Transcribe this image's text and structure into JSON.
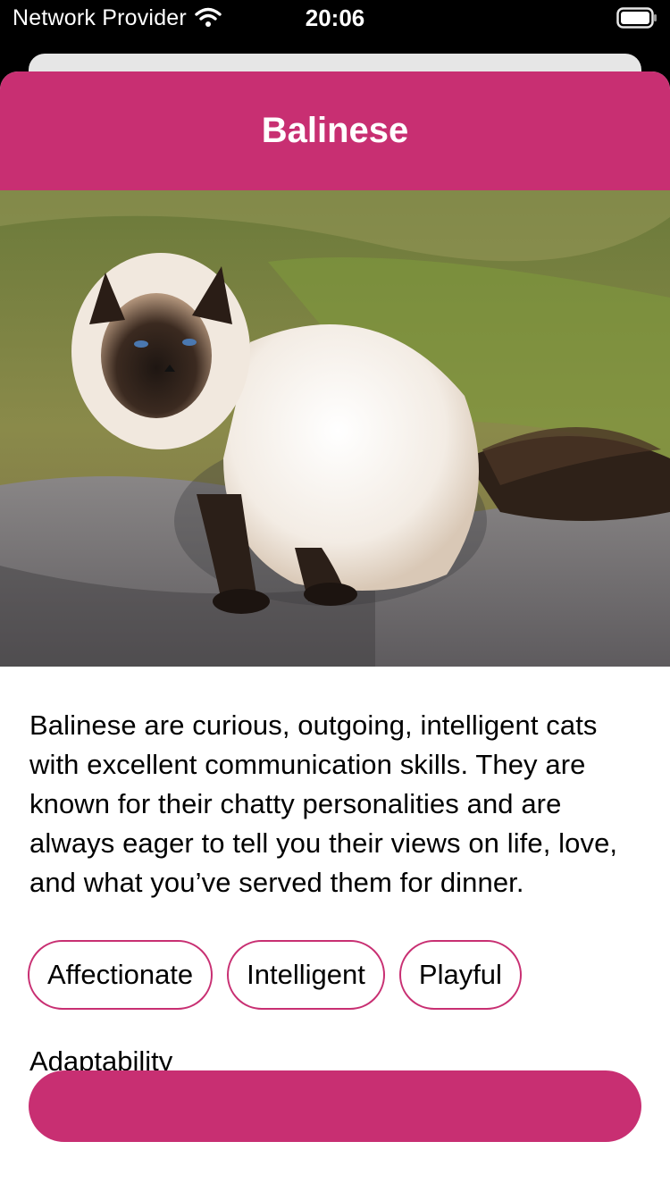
{
  "status_bar": {
    "carrier": "Network Provider",
    "time": "20:06",
    "wifi_icon": "wifi-icon",
    "battery_icon": "battery-icon"
  },
  "breed": {
    "title": "Balinese",
    "photo_alt": "Balinese cat",
    "description": "Balinese are curious, outgoing, intelligent cats with excellent communication skills. They are known for their chatty personalities and are always eager to tell you their views on life, love, and what you’ve served them for dinner.",
    "temperament_tags": [
      "Affectionate",
      "Intelligent",
      "Playful"
    ],
    "adaptability_label": "Adaptability"
  },
  "colors": {
    "accent": "#c82f72",
    "status_bar_bg": "#000000",
    "back_card": "#e6e6e6"
  }
}
